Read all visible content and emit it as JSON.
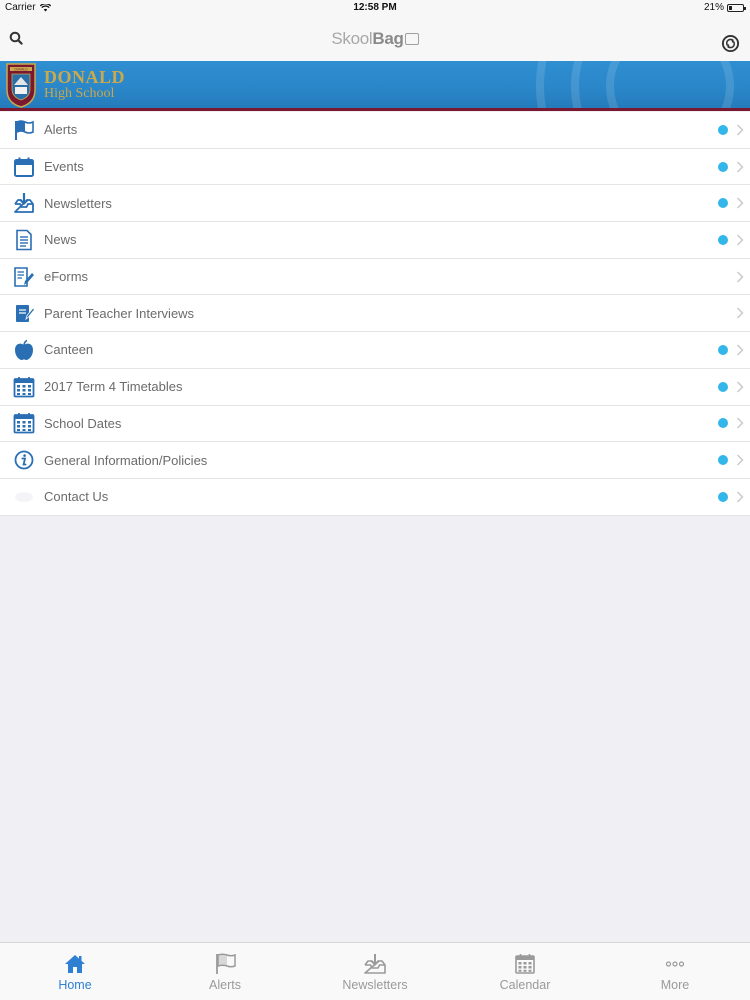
{
  "status_bar": {
    "carrier": "Carrier",
    "time": "12:58 PM",
    "battery": "21%",
    "battery_level": 0.21
  },
  "nav_bar": {
    "logo_light": "Skool",
    "logo_bold": "Bag"
  },
  "banner": {
    "name_line1": "DONALD",
    "name_line2": "High School",
    "crest_text": "DONALD"
  },
  "colors": {
    "accent": "#2f7fd2",
    "badge": "#33b6ea",
    "banner": "#2a86c8",
    "banner_border": "#7a1830",
    "gold": "#c9a94c"
  },
  "menu": {
    "items": [
      {
        "label": "Alerts",
        "icon": "flag-icon",
        "badge": true
      },
      {
        "label": "Events",
        "icon": "calendar-icon",
        "badge": true
      },
      {
        "label": "Newsletters",
        "icon": "inbox-download-icon",
        "badge": true
      },
      {
        "label": "News",
        "icon": "document-icon",
        "badge": true
      },
      {
        "label": "eForms",
        "icon": "form-pencil-icon",
        "badge": false
      },
      {
        "label": "Parent Teacher Interviews",
        "icon": "notebook-pencil-icon",
        "badge": false
      },
      {
        "label": "Canteen",
        "icon": "apple-icon",
        "badge": true
      },
      {
        "label": "2017 Term 4 Timetables",
        "icon": "calendar-grid-icon",
        "badge": true
      },
      {
        "label": "School Dates",
        "icon": "calendar-grid-icon",
        "badge": true
      },
      {
        "label": "General Information/Policies",
        "icon": "info-icon",
        "badge": true
      },
      {
        "label": "Contact Us",
        "icon": "contact-icon",
        "badge": true
      }
    ]
  },
  "tabs": [
    {
      "label": "Home",
      "icon": "home-icon",
      "active": true
    },
    {
      "label": "Alerts",
      "icon": "flag-icon",
      "active": false
    },
    {
      "label": "Newsletters",
      "icon": "inbox-download-icon",
      "active": false
    },
    {
      "label": "Calendar",
      "icon": "calendar-grid-icon",
      "active": false
    },
    {
      "label": "More",
      "icon": "more-dots-icon",
      "active": false
    }
  ]
}
